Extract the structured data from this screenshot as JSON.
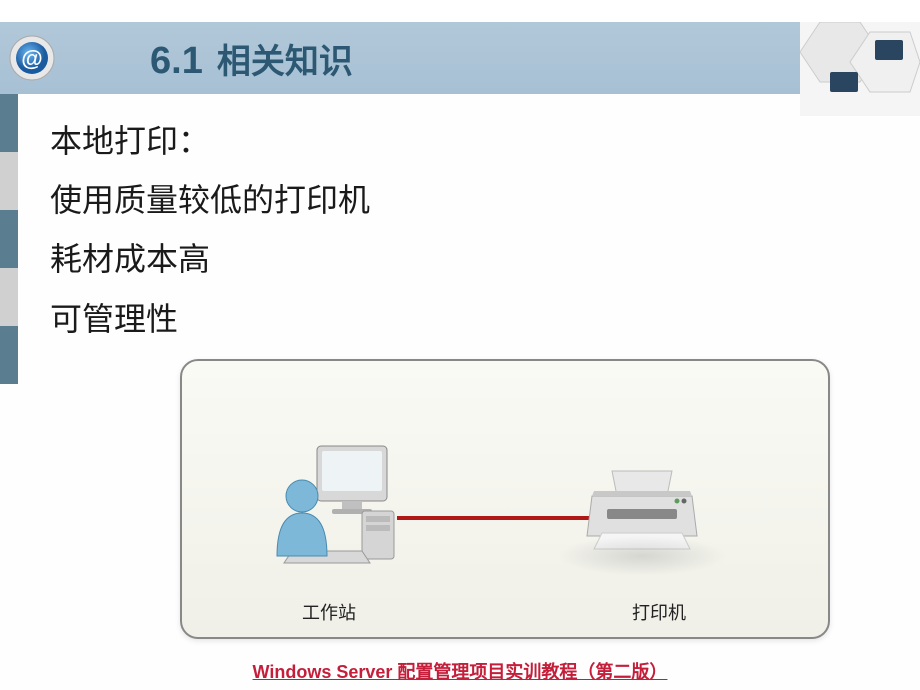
{
  "header": {
    "number": "6.1",
    "title": "相关知识"
  },
  "bullets": {
    "b1": "本地打印：",
    "b2": "使用质量较低的打印机",
    "b3": "耗材成本高",
    "b4": "可管理性"
  },
  "diagram": {
    "workstation_label": "工作站",
    "printer_label": "打印机"
  },
  "footer": "Windows Server 配置管理项目实训教程（第二版）"
}
